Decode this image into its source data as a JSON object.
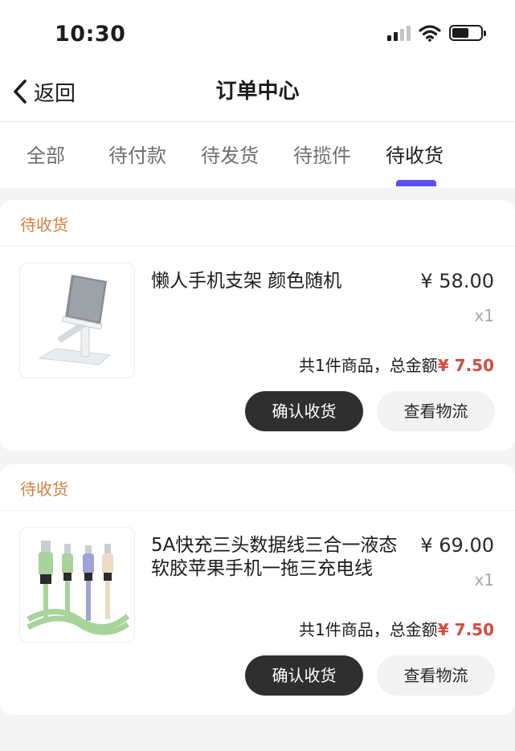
{
  "status_bar": {
    "time": "10:30"
  },
  "navbar": {
    "back_label": "返回",
    "title": "订单中心"
  },
  "tabs": [
    {
      "label": "全部",
      "active": false
    },
    {
      "label": "待付款",
      "active": false
    },
    {
      "label": "待发货",
      "active": false
    },
    {
      "label": "待揽件",
      "active": false
    },
    {
      "label": "待收货",
      "active": true
    }
  ],
  "orders": [
    {
      "status": "待收货",
      "product_name": "懒人手机支架  颜色随机",
      "price": "¥ 58.00",
      "quantity": "x1",
      "summary_prefix": "共1件商品，总金额",
      "total": "¥ 7.50",
      "confirm_label": "确认收货",
      "logistics_label": "查看物流",
      "thumb_icon": "phone-stand-icon"
    },
    {
      "status": "待收货",
      "product_name": "5A快充三头数据线三合一液态软胶苹果手机一拖三充电线",
      "price": "¥ 69.00",
      "quantity": "x1",
      "summary_prefix": "共1件商品，总金额",
      "total": "¥ 7.50",
      "confirm_label": "确认收货",
      "logistics_label": "查看物流",
      "thumb_icon": "charging-cable-icon"
    }
  ],
  "colors": {
    "accent": "#5a4ff3",
    "status_text": "#d4803f",
    "total_text": "#d54a3c",
    "primary_button": "#2f2f2f"
  }
}
